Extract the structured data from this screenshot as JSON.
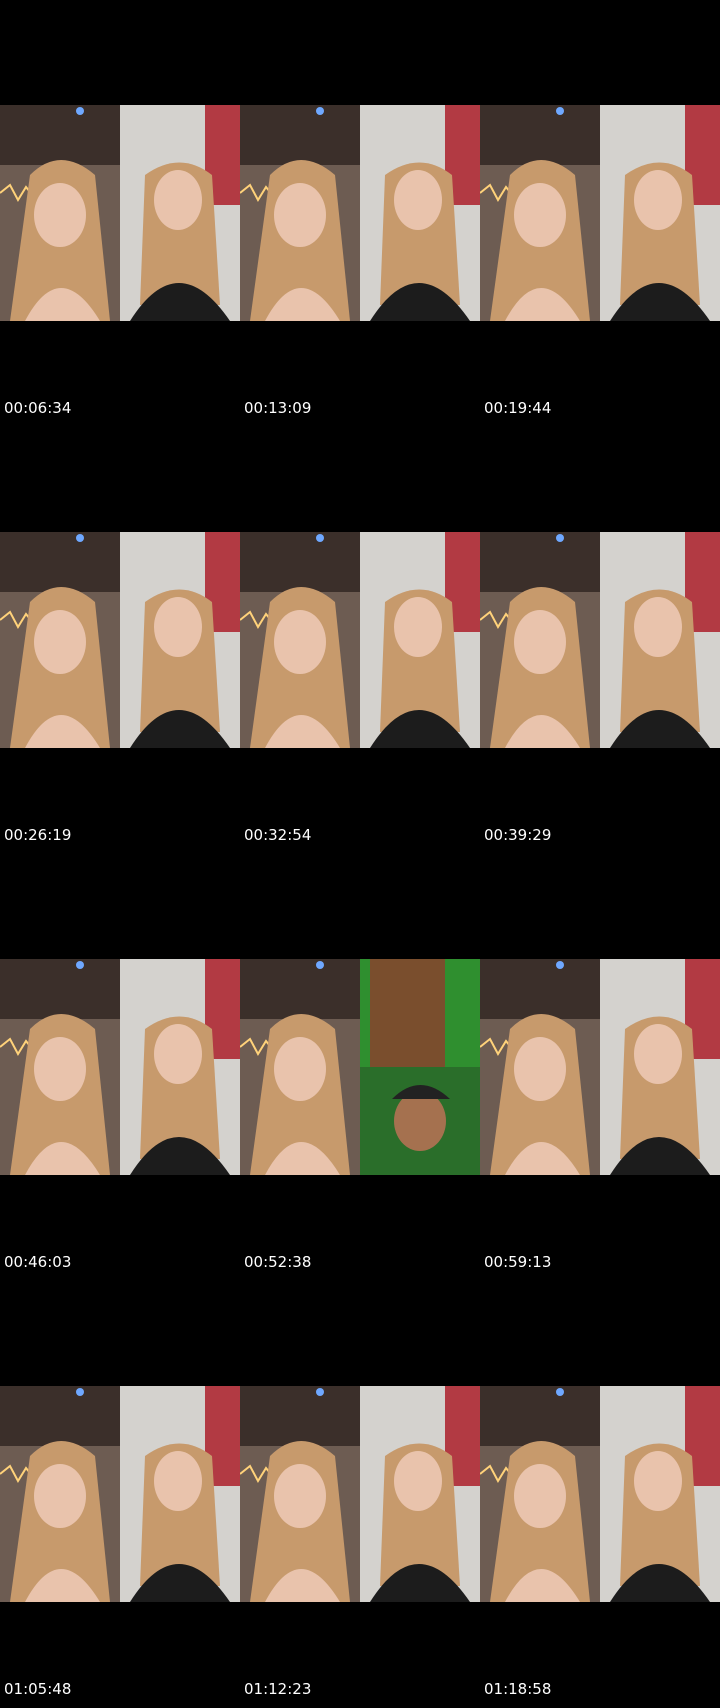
{
  "contact_sheet": {
    "thumbnails": [
      {
        "time": "00:06:34",
        "left_scene": "room",
        "right_scene": "wall"
      },
      {
        "time": "00:13:09",
        "left_scene": "room",
        "right_scene": "wall"
      },
      {
        "time": "00:19:44",
        "left_scene": "room",
        "right_scene": "wall"
      },
      {
        "time": "00:26:19",
        "left_scene": "room",
        "right_scene": "wall"
      },
      {
        "time": "00:32:54",
        "left_scene": "room",
        "right_scene": "wall"
      },
      {
        "time": "00:39:29",
        "left_scene": "room",
        "right_scene": "wall"
      },
      {
        "time": "00:46:03",
        "left_scene": "room",
        "right_scene": "wall"
      },
      {
        "time": "00:52:38",
        "left_scene": "room",
        "right_scene": "green"
      },
      {
        "time": "00:59:13",
        "left_scene": "room",
        "right_scene": "wall"
      },
      {
        "time": "01:05:48",
        "left_scene": "room",
        "right_scene": "wall"
      },
      {
        "time": "01:12:23",
        "left_scene": "room",
        "right_scene": "wall"
      },
      {
        "time": "01:18:58",
        "left_scene": "room",
        "right_scene": "wall"
      }
    ]
  },
  "colors": {
    "background": "#000000",
    "timestamp_text": "#ffffff",
    "room_ceiling": "#3b2f2a",
    "room_wall": "#6d5c52",
    "skin": "#e9c3ac",
    "hair": "#c79a6c",
    "shirt": "#1c1c1c",
    "marble": "#d4d2ce",
    "poster": "#b23a43",
    "green_screen": "#2f8f2f",
    "door": "#7a4e2d"
  }
}
